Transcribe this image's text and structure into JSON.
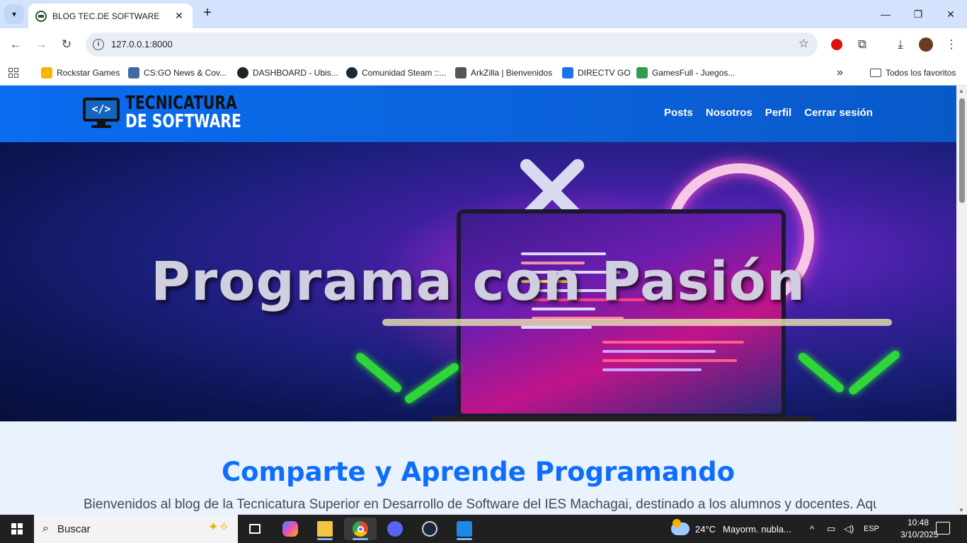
{
  "browser": {
    "tab": {
      "title": "BLOG TEC.DE SOFTWARE",
      "close_glyph": "✕"
    },
    "new_tab_glyph": "+",
    "window_controls": {
      "minimize": "—",
      "restore": "❐",
      "close": "✕"
    },
    "toolbar": {
      "back": "←",
      "forward": "→",
      "reload": "↻"
    },
    "address": {
      "url": "127.0.0.1:8000",
      "info_glyph": "i",
      "star_glyph": "☆"
    },
    "extensions": {
      "download": "⤓",
      "puzzle": "⧉",
      "menu": "⋮"
    },
    "bookmarks": [
      {
        "label": "Rockstar Games",
        "color": "#f7b500"
      },
      {
        "label": "CS:GO News & Cov...",
        "color": "#3f6aa6"
      },
      {
        "label": "DASHBOARD - Ubis...",
        "color": "#222222"
      },
      {
        "label": "Comunidad Steam ::...",
        "color": "#1b2838"
      },
      {
        "label": "ArkZilla | Bienvenidos",
        "color": "#555555"
      },
      {
        "label": "DIRECTV GO",
        "color": "#1a73e8"
      },
      {
        "label": "GamesFull - Juegos...",
        "color": "#2e9d4f"
      }
    ],
    "bookmarks_overflow": "»",
    "all_bookmarks": "Todos los favoritos"
  },
  "site": {
    "logo": {
      "line1": "TECNICATURA",
      "line2": "DE SOFTWARE",
      "screen_glyph": "</>"
    },
    "nav": [
      "Posts",
      "Nosotros",
      "Perfil",
      "Cerrar sesión"
    ],
    "hero_title": "Programa con Pasión",
    "section_title": "Comparte y Aprende Programando",
    "section_text": "Bienvenidos al blog de la Tecnicatura Superior en Desarrollo de Software del IES Machagai, destinado a los alumnos y docentes. Aquí",
    "accent_color": "#0d6efd"
  },
  "taskbar": {
    "search_placeholder": "Buscar",
    "apps": [
      "task-view",
      "copilot",
      "file-explorer",
      "chrome",
      "discord",
      "steam",
      "vscode"
    ],
    "weather": {
      "temp": "24°C",
      "desc": "Mayorm. nubla..."
    },
    "language": "ESP",
    "time": "10:48",
    "date": "3/10/2025"
  }
}
